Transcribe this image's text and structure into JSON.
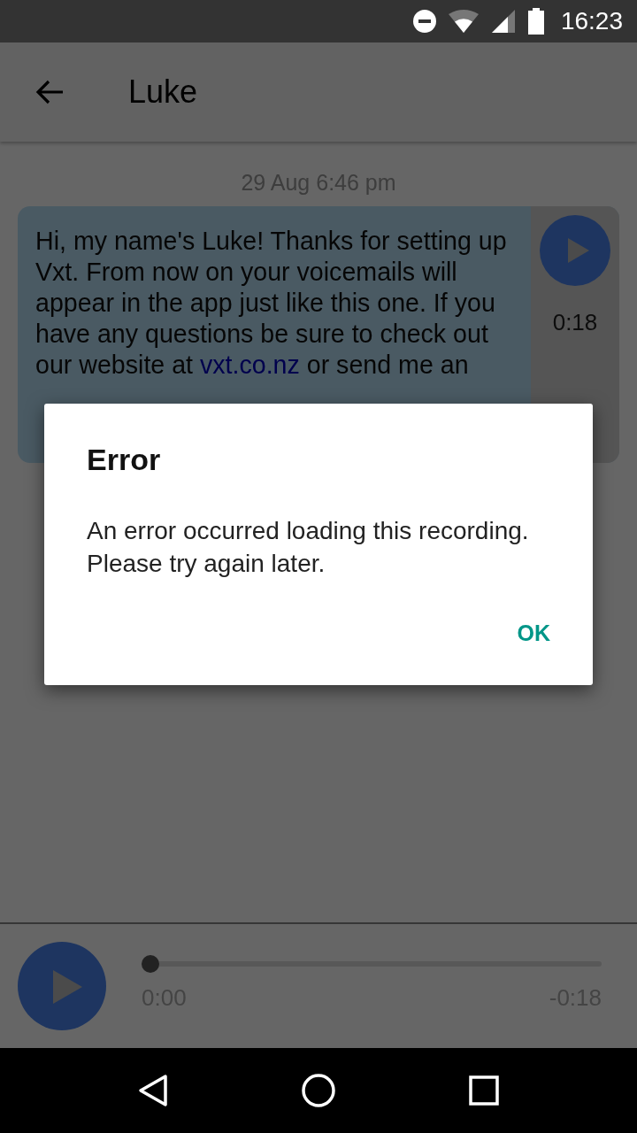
{
  "status_bar": {
    "time": "16:23"
  },
  "app_bar": {
    "title": "Luke"
  },
  "messages": [
    {
      "timestamp": "29 Aug 6:46 pm",
      "duration": "0:18",
      "body": [
        {
          "kind": "text",
          "text": "Hi, my name's Luke! Thanks for setting up Vxt. From now on your voicemails will appear in the app just like this one. If you have any questions be sure to check out our website at "
        },
        {
          "kind": "link",
          "text": "vxt.co.nz"
        },
        {
          "kind": "text",
          "text": " or send me an"
        }
      ]
    }
  ],
  "player": {
    "level": 0,
    "elapsed": "0:00",
    "remaining": "-0:18"
  },
  "dialog": {
    "title": "Error",
    "message": "An error occurred loading this recording. Please try again later.",
    "buttons": [
      "OK"
    ]
  }
}
